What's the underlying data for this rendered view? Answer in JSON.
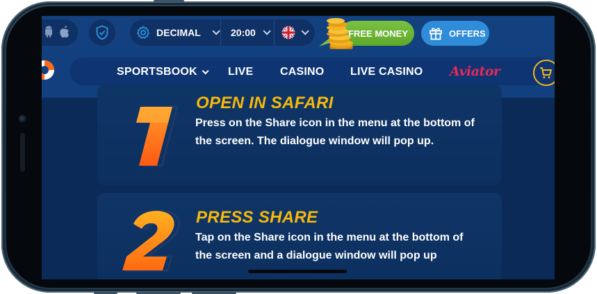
{
  "topbar": {
    "odds_format": "DECIMAL",
    "time": "20:00",
    "free_money_label": "FREE MONEY",
    "offers_label": "OFFERS"
  },
  "nav": {
    "items": [
      {
        "label": "SPORTSBOOK"
      },
      {
        "label": "LIVE"
      },
      {
        "label": "CASINO"
      },
      {
        "label": "LIVE CASINO"
      }
    ],
    "aviator_label": "Aviator"
  },
  "steps": [
    {
      "number": "1",
      "title": "OPEN IN SAFARI",
      "line1": "Press on the Share icon in the menu at the bottom of",
      "line2": "the screen. The dialogue window will pop up."
    },
    {
      "number": "2",
      "title": "PRESS SHARE",
      "line1": "Tap on the Share icon in the menu at the bottom of",
      "line2": "the screen and a dialogue window will pop up"
    }
  ],
  "colors": {
    "accent_orange": "#f6b80c",
    "bg_navy": "#0b2a57",
    "green": "#6ab132",
    "blue_button": "#2e8cd8",
    "aviator_red": "#e8285b"
  },
  "icons": [
    "android-icon",
    "apple-icon",
    "shield-icon",
    "gear-icon",
    "uk-flag-icon",
    "gift-icon",
    "cart-icon",
    "lifebuoy-icon",
    "coins-icon"
  ]
}
